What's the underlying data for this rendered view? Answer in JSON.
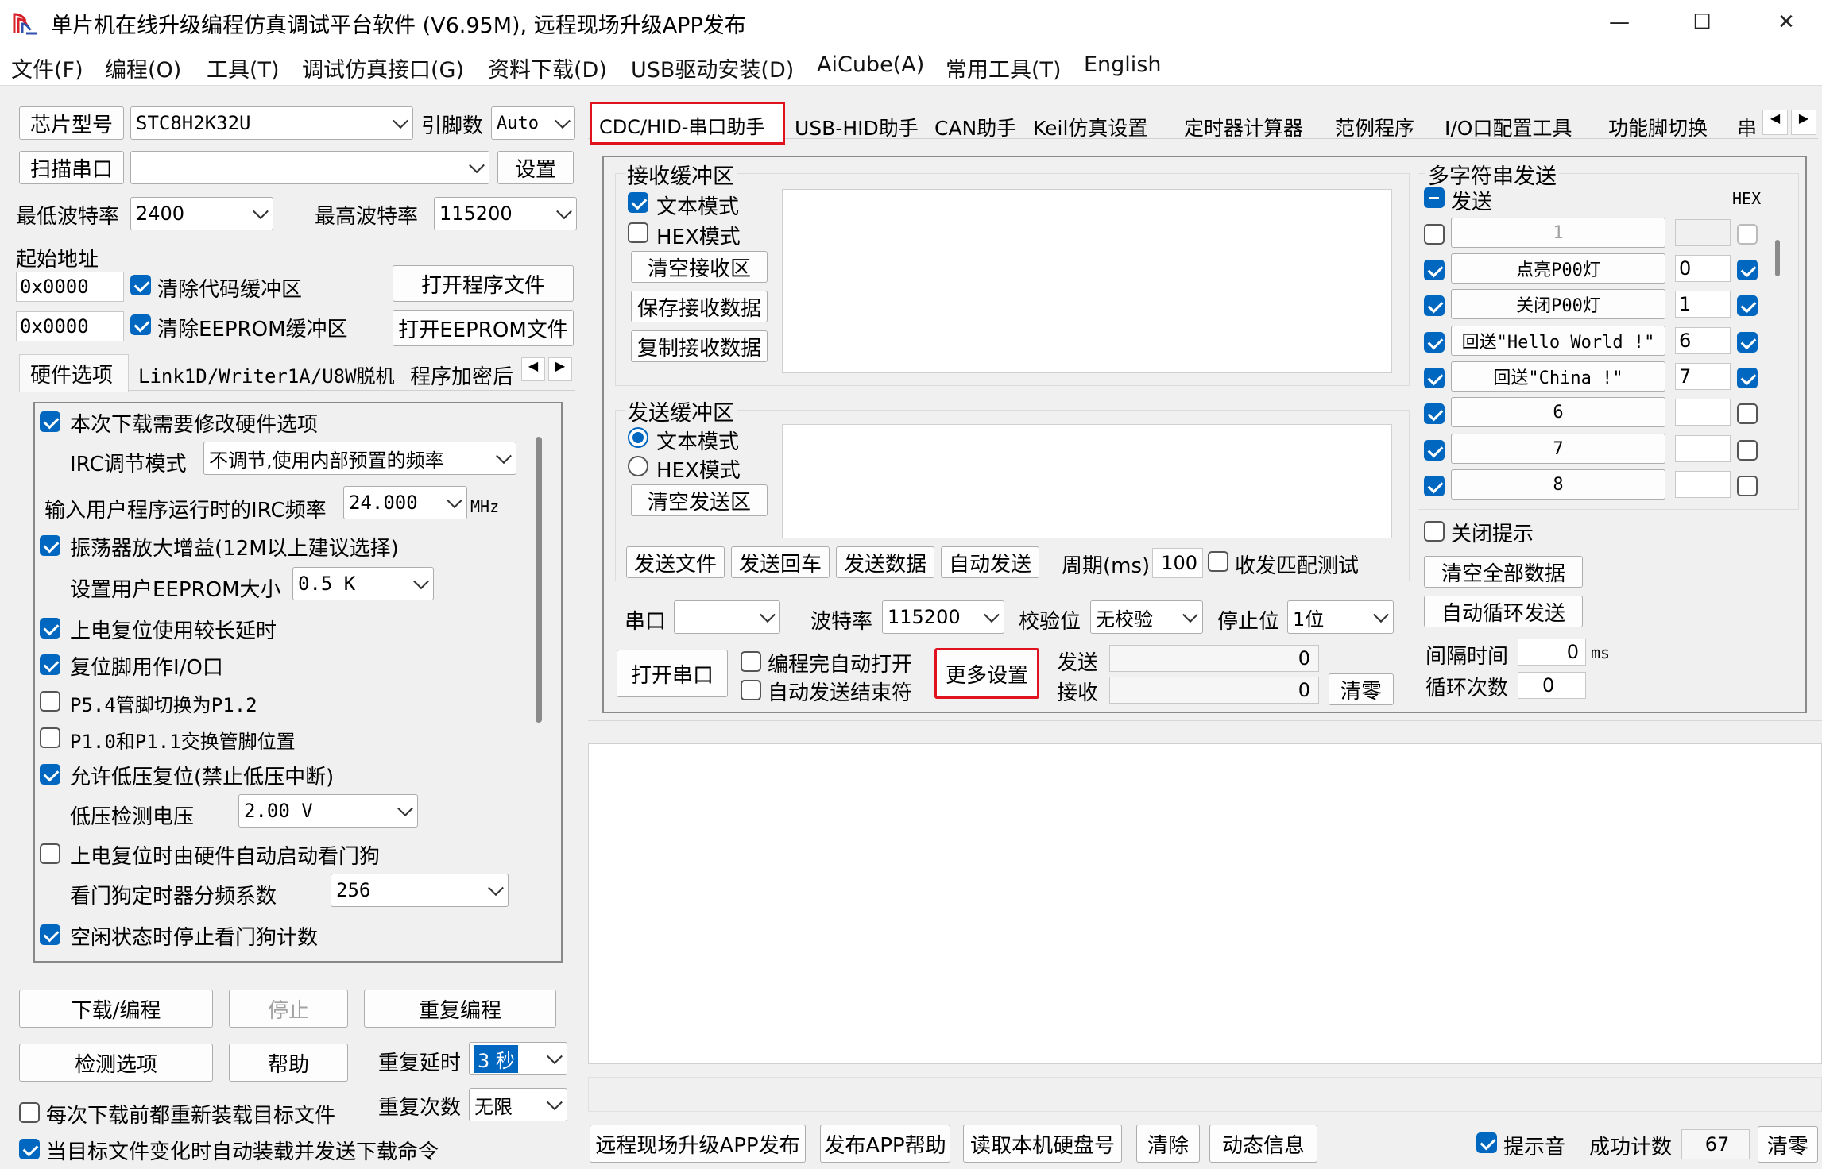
{
  "window": {
    "title": "单片机在线升级编程仿真调试平台软件 (V6.95M), 远程现场升级APP发布",
    "buttons": [
      "—",
      "☐",
      "✕"
    ]
  },
  "menu": [
    "文件(F)",
    "编程(O)",
    "工具(T)",
    "调试仿真接口(G)",
    "资料下载(D)",
    "USB驱动安装(D)",
    "AiCube(A)",
    "常用工具(T)",
    "English"
  ],
  "left": {
    "chip_model_btn": "芯片型号",
    "chip_model": "STC8H2K32U",
    "pins_label": "引脚数",
    "pins": "Auto",
    "scan_port_btn": "扫描串口",
    "port_value": "",
    "settings_btn": "设置",
    "min_baud_label": "最低波特率",
    "min_baud": "2400",
    "max_baud_label": "最高波特率",
    "max_baud": "115200",
    "start_addr_label": "起始地址",
    "addr1": "0x0000",
    "clear_code_buf": "清除代码缓冲区",
    "open_prog_file": "打开程序文件",
    "addr2": "0x0000",
    "clear_eeprom_buf": "清除EEPROM缓冲区",
    "open_eeprom_file": "打开EEPROM文件",
    "tabs": [
      "硬件选项",
      "Link1D/Writer1A/U8W脱机",
      "程序加密后"
    ],
    "hw": {
      "modify_hw": "本次下载需要修改硬件选项",
      "irc_mode_label": "IRC调节模式",
      "irc_mode": "不调节,使用内部预置的频率",
      "irc_freq_label": "输入用户程序运行时的IRC频率",
      "irc_freq": "24.000",
      "irc_unit": "MHz",
      "osc_gain": "振荡器放大增益(12M以上建议选择)",
      "eeprom_size_label": "设置用户EEPROM大小",
      "eeprom_size": "0.5 K",
      "long_delay": "上电复位使用较长延时",
      "reset_io": "复位脚用作I/O口",
      "p54": "P5.4管脚切换为P1.2",
      "p10": "P1.0和P1.1交换管脚位置",
      "lvr": "允许低压复位(禁止低压中断)",
      "lvd_label": "低压检测电压",
      "lvd": "2.00 V",
      "wdt_auto": "上电复位时由硬件自动启动看门狗",
      "wdt_div_label": "看门狗定时器分频系数",
      "wdt_div": "256",
      "idle_wdt": "空闲状态时停止看门狗计数"
    },
    "download_btn": "下载/编程",
    "stop_btn": "停止",
    "reprogram_btn": "重复编程",
    "check_opt_btn": "检测选项",
    "help_btn": "帮助",
    "repeat_delay_label": "重复延时",
    "repeat_delay": "3 秒",
    "repeat_count_label": "重复次数",
    "repeat_count": "无限",
    "reload_each": "每次下载前都重新装载目标文件",
    "auto_reload": "当目标文件变化时自动装载并发送下载命令"
  },
  "tabs": [
    "CDC/HID-串口助手",
    "USB-HID助手",
    "CAN助手",
    "Keil仿真设置",
    "定时器计算器",
    "范例程序",
    "I/O口配置工具",
    "功能脚切换",
    "串"
  ],
  "serial": {
    "recv_title": "接收缓冲区",
    "text_mode": "文本模式",
    "hex_mode": "HEX模式",
    "clear_recv": "清空接收区",
    "save_recv": "保存接收数据",
    "copy_recv": "复制接收数据",
    "send_title": "发送缓冲区",
    "clear_send": "清空发送区",
    "send_file": "发送文件",
    "send_enter": "发送回车",
    "send_data": "发送数据",
    "auto_send": "自动发送",
    "period_label": "周期(ms)",
    "period": "100",
    "match_test": "收发匹配测试",
    "port_label": "串口",
    "baud_label": "波特率",
    "baud": "115200",
    "parity_label": "校验位",
    "parity": "无校验",
    "stop_label": "停止位",
    "stop": "1位",
    "open_port": "打开串口",
    "auto_open": "编程完自动打开",
    "auto_end": "自动发送结束符",
    "more_settings": "更多设置",
    "send_label": "发送",
    "send_count": "0",
    "recv_label": "接收",
    "recv_count": "0",
    "clear_count": "清零"
  },
  "multi": {
    "title": "多字符串发送",
    "send_header": "发送",
    "hex_header": "HEX",
    "rows": [
      {
        "label": "1",
        "value": "",
        "enabled": false
      },
      {
        "label": "点亮P00灯",
        "value": "0",
        "enabled": true
      },
      {
        "label": "关闭P00灯",
        "value": "1",
        "enabled": true
      },
      {
        "label": "回送\"Hello World !\"",
        "value": "6",
        "enabled": true
      },
      {
        "label": "回送\"China !\"",
        "value": "7",
        "enabled": true
      },
      {
        "label": "6",
        "value": "",
        "enabled": true
      },
      {
        "label": "7",
        "value": "",
        "enabled": true
      },
      {
        "label": "8",
        "value": "",
        "enabled": true
      }
    ],
    "close_tips": "关闭提示",
    "clear_all": "清空全部数据",
    "auto_loop": "自动循环发送",
    "interval_label": "间隔时间",
    "interval": "0",
    "interval_unit": "ms",
    "loop_label": "循环次数",
    "loop": "0"
  },
  "bottom": {
    "publish": "远程现场升级APP发布",
    "publish_help": "发布APP帮助",
    "read_hd": "读取本机硬盘号",
    "clear": "清除",
    "dynamic": "动态信息",
    "beep": "提示音",
    "success_label": "成功计数",
    "success": "67",
    "clear_zero": "清零"
  }
}
